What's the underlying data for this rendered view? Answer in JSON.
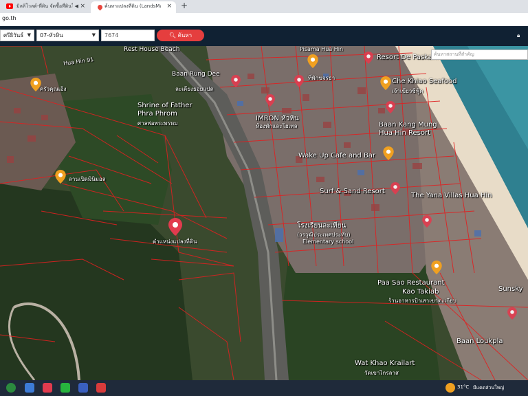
{
  "browser": {
    "tabs": [
      {
        "title": "มิลลิโวลต์-ที่ดิน จัดซื้อที่ดินในหัวหิน",
        "icon": "youtube-icon",
        "audio": "◀"
      },
      {
        "title": "ค้นหาแปลงที่ดิน (LandsMaps)",
        "icon": "map-pin-icon"
      }
    ],
    "close_glyph": "×",
    "new_tab_glyph": "+",
    "url": "go.th"
  },
  "toolbar": {
    "province": "ศรีธิวันธ์",
    "district": "07-หัวหิน",
    "parcel_number": "7674",
    "search_label": "ค้นหา",
    "place_search_placeholder": "ค้นหาสถานที่สำคัญ"
  },
  "map": {
    "labels": [
      {
        "text": "Rest House Beach",
        "kind": "place"
      },
      {
        "text": "Hua Hin 91",
        "kind": "road"
      },
      {
        "text": "Baan Rung Dee",
        "kind": "place"
      },
      {
        "text": "ละเคียงธอยแปด",
        "kind": "thai"
      },
      {
        "text": "Pisama Hua Hin",
        "kind": "place"
      },
      {
        "text": "Resort De Paskani",
        "kind": "place"
      },
      {
        "text": "ครัวคุณเอิง",
        "kind": "thai"
      },
      {
        "text": "Che Khiao Seafood",
        "kind": "place"
      },
      {
        "text": "เจ้าเขียวซีฟู้ด",
        "kind": "thai"
      },
      {
        "text": "ที่พักขจรธา",
        "kind": "thai"
      },
      {
        "text": "Shrine of Father",
        "kind": "place"
      },
      {
        "text": "Phra Phrom",
        "kind": "place"
      },
      {
        "text": "ศาลพ่อพระพรหม",
        "kind": "thai"
      },
      {
        "text": "IMRON หัวหิน",
        "kind": "place"
      },
      {
        "text": "ห้องพักและโฮเทล",
        "kind": "thai"
      },
      {
        "text": "Baan Kang Mung",
        "kind": "place"
      },
      {
        "text": "Hua Hin Resort",
        "kind": "place"
      },
      {
        "text": "Wake Up Cafe and Bar",
        "kind": "place"
      },
      {
        "text": "ลานเปิดมินิมอล",
        "kind": "thai"
      },
      {
        "text": "Surf & Sand Resort",
        "kind": "place"
      },
      {
        "text": "The Yana Villas Hua Hin",
        "kind": "place"
      },
      {
        "text": "โรงเรียนละเทียน",
        "kind": "thai"
      },
      {
        "text": "(วรวุฒิประเทศประทับ)",
        "kind": "thai"
      },
      {
        "text": "Elementary school",
        "kind": "place"
      },
      {
        "text": "ตำแหน่งแปลงที่ดิน",
        "kind": "thai"
      },
      {
        "text": "Paa Sao Restaurant",
        "kind": "place"
      },
      {
        "text": "Kao Takiab",
        "kind": "place"
      },
      {
        "text": "ร้านอาหารป้าเสาเขาตะเกียบ",
        "kind": "thai"
      },
      {
        "text": "Sunsky",
        "kind": "place"
      },
      {
        "text": "Baan Loukpla",
        "kind": "place"
      },
      {
        "text": "Wat Khao Krailart",
        "kind": "place"
      },
      {
        "text": "วัดเขาไกรลาส",
        "kind": "thai"
      }
    ]
  },
  "taskbar": {
    "weather_temp": "31°C",
    "weather_text": "มีแดดส่วนใหญ่"
  },
  "colors": {
    "toolbar_bg": "#102133",
    "search_button": "#e53e3e",
    "parcel_line": "#e02020",
    "pin_red": "#e23b4e",
    "pin_orange": "#f0a020",
    "sea": "#2f8090",
    "beach": "#e8dcc8"
  }
}
